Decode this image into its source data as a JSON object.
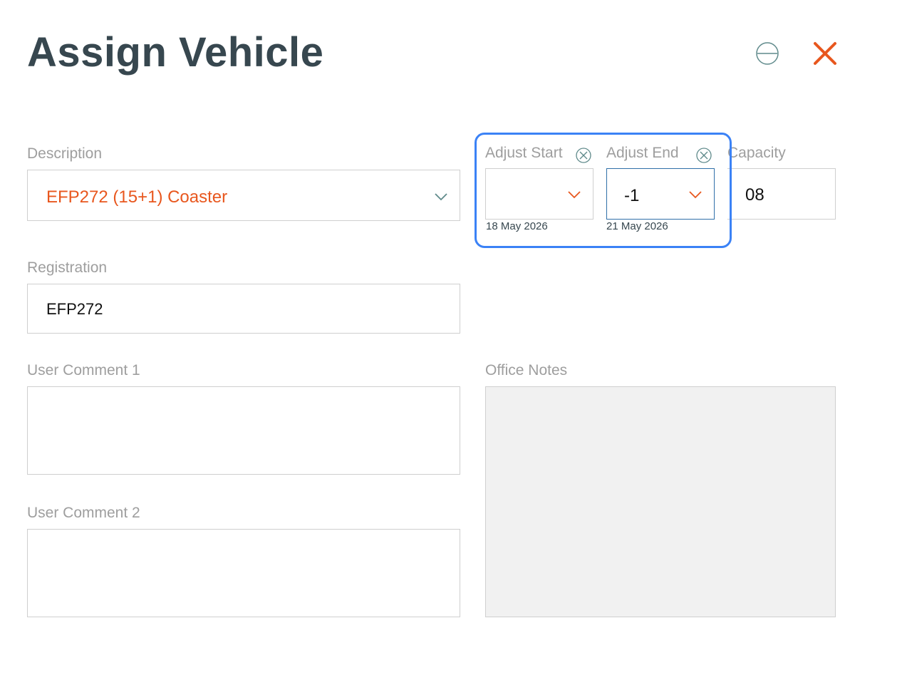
{
  "dialog": {
    "title": "Assign Vehicle",
    "minimize_icon": "minus-circle-icon",
    "close_icon": "close-x-icon"
  },
  "description": {
    "label": "Description",
    "value": "EFP272 (15+1) Coaster",
    "value_color": "#e8571e"
  },
  "adjust_start": {
    "label": "Adjust Start",
    "value": "",
    "date_note": "18 May 2026"
  },
  "adjust_end": {
    "label": "Adjust End",
    "value": "-1",
    "date_note": "21 May 2026"
  },
  "capacity": {
    "label": "Capacity",
    "value": "08"
  },
  "registration": {
    "label": "Registration",
    "value": "EFP272"
  },
  "user_comment_1": {
    "label": "User Comment 1",
    "value": ""
  },
  "user_comment_2": {
    "label": "User Comment 2",
    "value": ""
  },
  "office_notes": {
    "label": "Office Notes",
    "value": ""
  },
  "colors": {
    "accent": "#e8571e",
    "title": "#37474f",
    "highlight": "#3b82f6"
  }
}
